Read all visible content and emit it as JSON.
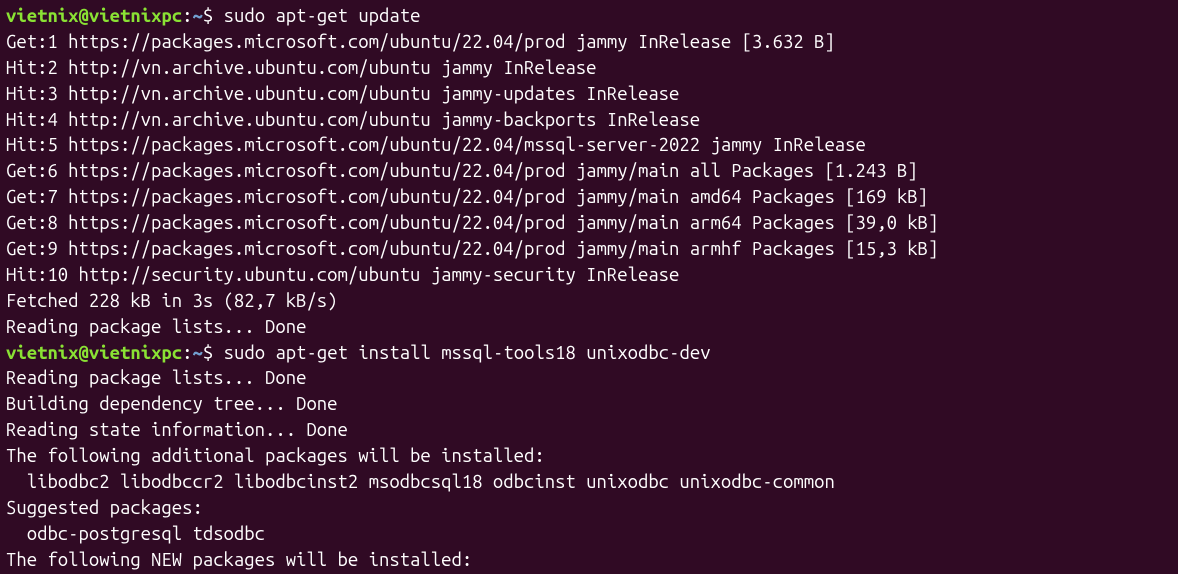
{
  "prompt1": {
    "user": "vietnix",
    "at": "@",
    "host": "vietnixpc",
    "colon": ":",
    "tilde": "~",
    "dollar": "$ ",
    "command": "sudo apt-get update"
  },
  "lines1": [
    "Get:1 https://packages.microsoft.com/ubuntu/22.04/prod jammy InRelease [3.632 B]",
    "Hit:2 http://vn.archive.ubuntu.com/ubuntu jammy InRelease",
    "Hit:3 http://vn.archive.ubuntu.com/ubuntu jammy-updates InRelease",
    "Hit:4 http://vn.archive.ubuntu.com/ubuntu jammy-backports InRelease",
    "Hit:5 https://packages.microsoft.com/ubuntu/22.04/mssql-server-2022 jammy InRelease",
    "Get:6 https://packages.microsoft.com/ubuntu/22.04/prod jammy/main all Packages [1.243 B]",
    "Get:7 https://packages.microsoft.com/ubuntu/22.04/prod jammy/main amd64 Packages [169 kB]",
    "Get:8 https://packages.microsoft.com/ubuntu/22.04/prod jammy/main arm64 Packages [39,0 kB]",
    "Get:9 https://packages.microsoft.com/ubuntu/22.04/prod jammy/main armhf Packages [15,3 kB]",
    "Hit:10 http://security.ubuntu.com/ubuntu jammy-security InRelease",
    "Fetched 228 kB in 3s (82,7 kB/s)",
    "Reading package lists... Done"
  ],
  "prompt2": {
    "user": "vietnix",
    "at": "@",
    "host": "vietnixpc",
    "colon": ":",
    "tilde": "~",
    "dollar": "$ ",
    "command": "sudo apt-get install mssql-tools18 unixodbc-dev"
  },
  "lines2": [
    "Reading package lists... Done",
    "Building dependency tree... Done",
    "Reading state information... Done",
    "The following additional packages will be installed:",
    "  libodbc2 libodbccr2 libodbcinst2 msodbcsql18 odbcinst unixodbc unixodbc-common",
    "Suggested packages:",
    "  odbc-postgresql tdsodbc",
    "The following NEW packages will be installed:"
  ]
}
